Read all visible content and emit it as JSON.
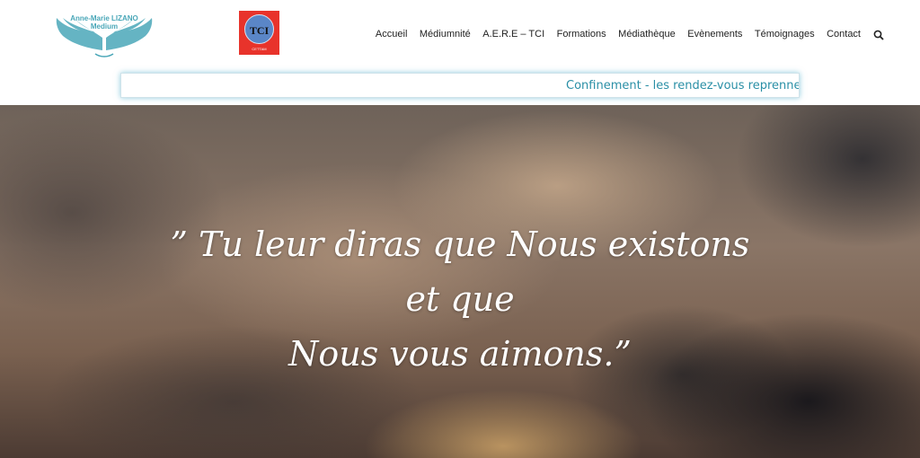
{
  "brand": {
    "name_line1": "Anne-Marie LIZANO",
    "name_line2": "Medium"
  },
  "partner_logo": {
    "letters": "TCI",
    "caption": "CETTAM"
  },
  "nav": {
    "items": [
      "Accueil",
      "Médiumnité",
      "A.E.R.E – TCI",
      "Formations",
      "Médiathèque",
      "Evènements",
      "Témoignages",
      "Contact"
    ]
  },
  "ticker": {
    "text": "Confinement - les rendez-vous reprennent e"
  },
  "hero": {
    "quote_line1": "” Tu leur diras que Nous existons",
    "quote_line2": "et que",
    "quote_line3": "Nous vous aimons.”"
  },
  "colors": {
    "accent": "#2a8fa6",
    "wings": "#4aa7b8",
    "tci_bg": "#e8332b"
  }
}
